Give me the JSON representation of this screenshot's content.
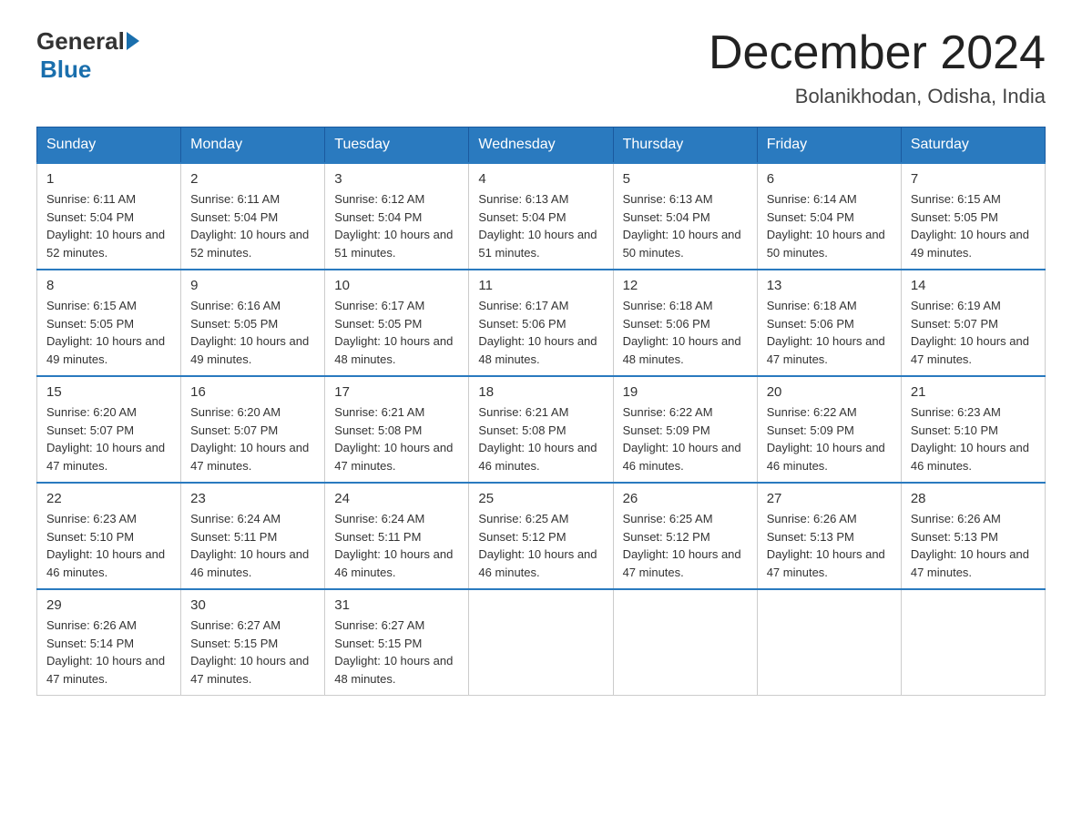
{
  "logo": {
    "general": "General",
    "blue": "Blue"
  },
  "title": "December 2024",
  "subtitle": "Bolanikhodan, Odisha, India",
  "headers": [
    "Sunday",
    "Monday",
    "Tuesday",
    "Wednesday",
    "Thursday",
    "Friday",
    "Saturday"
  ],
  "weeks": [
    [
      {
        "day": "1",
        "sunrise": "6:11 AM",
        "sunset": "5:04 PM",
        "daylight": "10 hours and 52 minutes."
      },
      {
        "day": "2",
        "sunrise": "6:11 AM",
        "sunset": "5:04 PM",
        "daylight": "10 hours and 52 minutes."
      },
      {
        "day": "3",
        "sunrise": "6:12 AM",
        "sunset": "5:04 PM",
        "daylight": "10 hours and 51 minutes."
      },
      {
        "day": "4",
        "sunrise": "6:13 AM",
        "sunset": "5:04 PM",
        "daylight": "10 hours and 51 minutes."
      },
      {
        "day": "5",
        "sunrise": "6:13 AM",
        "sunset": "5:04 PM",
        "daylight": "10 hours and 50 minutes."
      },
      {
        "day": "6",
        "sunrise": "6:14 AM",
        "sunset": "5:04 PM",
        "daylight": "10 hours and 50 minutes."
      },
      {
        "day": "7",
        "sunrise": "6:15 AM",
        "sunset": "5:05 PM",
        "daylight": "10 hours and 49 minutes."
      }
    ],
    [
      {
        "day": "8",
        "sunrise": "6:15 AM",
        "sunset": "5:05 PM",
        "daylight": "10 hours and 49 minutes."
      },
      {
        "day": "9",
        "sunrise": "6:16 AM",
        "sunset": "5:05 PM",
        "daylight": "10 hours and 49 minutes."
      },
      {
        "day": "10",
        "sunrise": "6:17 AM",
        "sunset": "5:05 PM",
        "daylight": "10 hours and 48 minutes."
      },
      {
        "day": "11",
        "sunrise": "6:17 AM",
        "sunset": "5:06 PM",
        "daylight": "10 hours and 48 minutes."
      },
      {
        "day": "12",
        "sunrise": "6:18 AM",
        "sunset": "5:06 PM",
        "daylight": "10 hours and 48 minutes."
      },
      {
        "day": "13",
        "sunrise": "6:18 AM",
        "sunset": "5:06 PM",
        "daylight": "10 hours and 47 minutes."
      },
      {
        "day": "14",
        "sunrise": "6:19 AM",
        "sunset": "5:07 PM",
        "daylight": "10 hours and 47 minutes."
      }
    ],
    [
      {
        "day": "15",
        "sunrise": "6:20 AM",
        "sunset": "5:07 PM",
        "daylight": "10 hours and 47 minutes."
      },
      {
        "day": "16",
        "sunrise": "6:20 AM",
        "sunset": "5:07 PM",
        "daylight": "10 hours and 47 minutes."
      },
      {
        "day": "17",
        "sunrise": "6:21 AM",
        "sunset": "5:08 PM",
        "daylight": "10 hours and 47 minutes."
      },
      {
        "day": "18",
        "sunrise": "6:21 AM",
        "sunset": "5:08 PM",
        "daylight": "10 hours and 46 minutes."
      },
      {
        "day": "19",
        "sunrise": "6:22 AM",
        "sunset": "5:09 PM",
        "daylight": "10 hours and 46 minutes."
      },
      {
        "day": "20",
        "sunrise": "6:22 AM",
        "sunset": "5:09 PM",
        "daylight": "10 hours and 46 minutes."
      },
      {
        "day": "21",
        "sunrise": "6:23 AM",
        "sunset": "5:10 PM",
        "daylight": "10 hours and 46 minutes."
      }
    ],
    [
      {
        "day": "22",
        "sunrise": "6:23 AM",
        "sunset": "5:10 PM",
        "daylight": "10 hours and 46 minutes."
      },
      {
        "day": "23",
        "sunrise": "6:24 AM",
        "sunset": "5:11 PM",
        "daylight": "10 hours and 46 minutes."
      },
      {
        "day": "24",
        "sunrise": "6:24 AM",
        "sunset": "5:11 PM",
        "daylight": "10 hours and 46 minutes."
      },
      {
        "day": "25",
        "sunrise": "6:25 AM",
        "sunset": "5:12 PM",
        "daylight": "10 hours and 46 minutes."
      },
      {
        "day": "26",
        "sunrise": "6:25 AM",
        "sunset": "5:12 PM",
        "daylight": "10 hours and 47 minutes."
      },
      {
        "day": "27",
        "sunrise": "6:26 AM",
        "sunset": "5:13 PM",
        "daylight": "10 hours and 47 minutes."
      },
      {
        "day": "28",
        "sunrise": "6:26 AM",
        "sunset": "5:13 PM",
        "daylight": "10 hours and 47 minutes."
      }
    ],
    [
      {
        "day": "29",
        "sunrise": "6:26 AM",
        "sunset": "5:14 PM",
        "daylight": "10 hours and 47 minutes."
      },
      {
        "day": "30",
        "sunrise": "6:27 AM",
        "sunset": "5:15 PM",
        "daylight": "10 hours and 47 minutes."
      },
      {
        "day": "31",
        "sunrise": "6:27 AM",
        "sunset": "5:15 PM",
        "daylight": "10 hours and 48 minutes."
      },
      null,
      null,
      null,
      null
    ]
  ]
}
